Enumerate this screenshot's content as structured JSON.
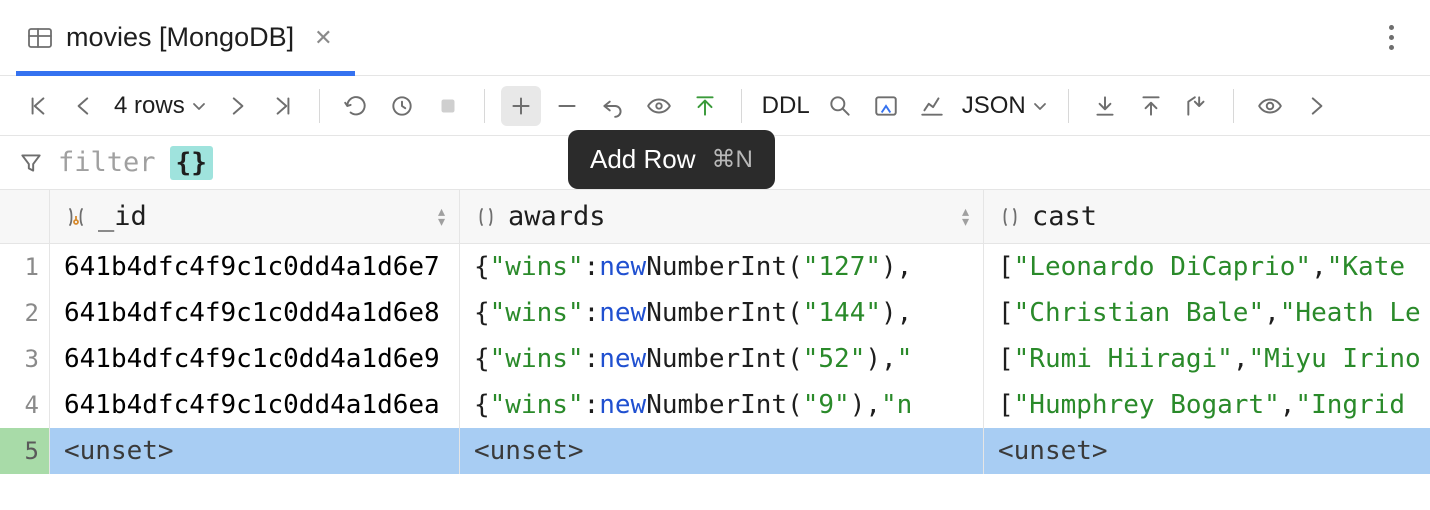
{
  "tab": {
    "title": "movies [MongoDB]"
  },
  "toolbar": {
    "rowcount": "4 rows",
    "ddl": "DDL",
    "format": "JSON"
  },
  "tooltip": {
    "label": "Add Row",
    "shortcut": "⌘N"
  },
  "filter": {
    "placeholder": "filter",
    "badge": "{}"
  },
  "columns": {
    "id": "_id",
    "awards": "awards",
    "cast": "cast"
  },
  "rows": [
    {
      "n": "1",
      "id": "641b4dfc4f9c1c0dd4a1d6e7",
      "awards_wins": "127",
      "awards_trail": "",
      "cast": [
        "Leonardo DiCaprio",
        "Kate"
      ]
    },
    {
      "n": "2",
      "id": "641b4dfc4f9c1c0dd4a1d6e8",
      "awards_wins": "144",
      "awards_trail": "",
      "cast": [
        "Christian Bale",
        "Heath Le"
      ]
    },
    {
      "n": "3",
      "id": "641b4dfc4f9c1c0dd4a1d6e9",
      "awards_wins": "52",
      "awards_trail": "\"",
      "cast": [
        "Rumi Hiiragi",
        "Miyu Irino"
      ]
    },
    {
      "n": "4",
      "id": "641b4dfc4f9c1c0dd4a1d6ea",
      "awards_wins": "9",
      "awards_trail": "\"n",
      "cast": [
        "Humphrey Bogart",
        "Ingrid"
      ]
    }
  ],
  "newrow": {
    "n": "5",
    "unset": "<unset>"
  }
}
